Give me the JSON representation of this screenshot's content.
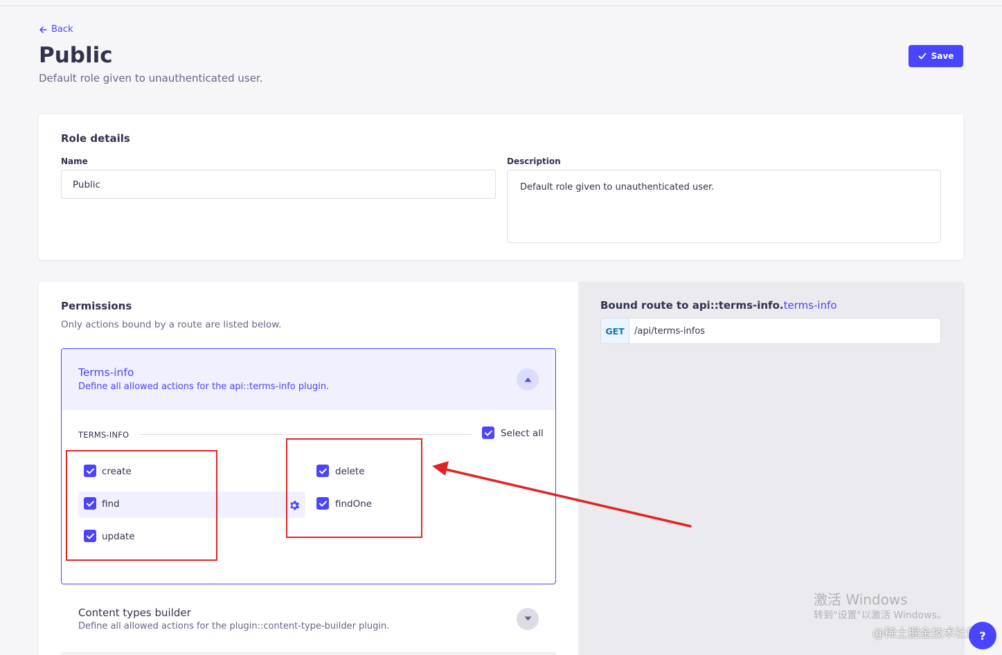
{
  "header": {
    "back_label": "Back",
    "title": "Public",
    "subtitle": "Default role given to unauthenticated user.",
    "save_label": "Save"
  },
  "role_details": {
    "title": "Role details",
    "name_label": "Name",
    "name_value": "Public",
    "description_label": "Description",
    "description_value": "Default role given to unauthenticated user."
  },
  "permissions": {
    "title": "Permissions",
    "subtitle": "Only actions bound by a route are listed below.",
    "plugins": [
      {
        "name": "Terms-info",
        "description": "Define all allowed actions for the api::terms-info plugin.",
        "expanded": true,
        "section_label": "TERMS-INFO",
        "select_all_label": "Select all",
        "select_all_checked": true,
        "actions": [
          {
            "label": "create",
            "checked": true
          },
          {
            "label": "find",
            "checked": true
          },
          {
            "label": "update",
            "checked": true
          },
          {
            "label": "delete",
            "checked": true
          },
          {
            "label": "findOne",
            "checked": true
          }
        ]
      },
      {
        "name": "Content types builder",
        "description": "Define all allowed actions for the plugin::content-type-builder plugin.",
        "expanded": false
      }
    ]
  },
  "bound_route": {
    "title_prefix": "Bound route to api::terms-info.",
    "title_highlight": "terms-info",
    "method": "GET",
    "path": "/api/terms-infos"
  },
  "watermarks": {
    "windows_line1": "激活 Windows",
    "windows_line2": "转到\"设置\"以激活 Windows。",
    "site": "@稀土掘金技术社区"
  },
  "help_label": "?",
  "colors": {
    "primary": "#4945ff",
    "annotation_red": "#e02424",
    "page_background": "#f6f6f9"
  }
}
